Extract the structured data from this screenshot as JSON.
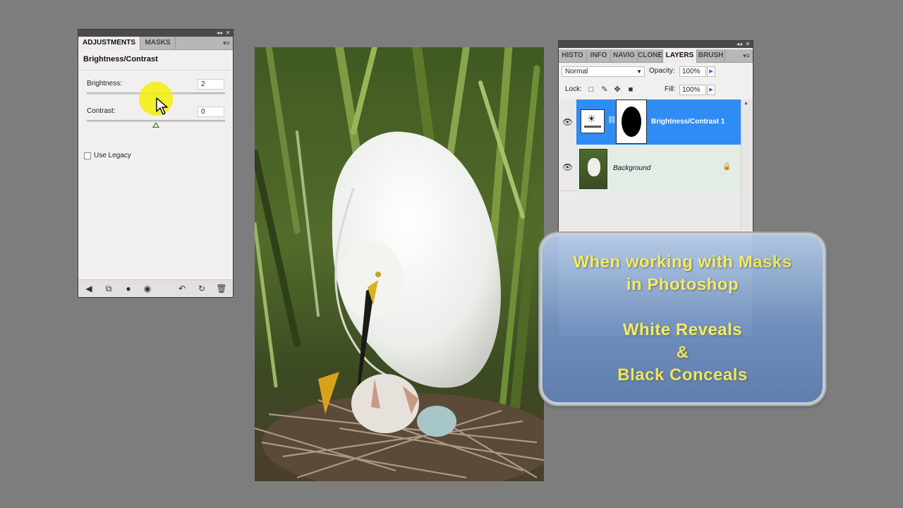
{
  "adjustments_panel": {
    "tabs": [
      {
        "label": "ADJUSTMENTS",
        "active": true
      },
      {
        "label": "MASKS",
        "active": false
      }
    ],
    "title": "Brightness/Contrast",
    "brightness": {
      "label": "Brightness:",
      "value": "2",
      "slider_fraction": 0.51
    },
    "contrast": {
      "label": "Contrast:",
      "value": "0",
      "slider_fraction": 0.5
    },
    "use_legacy": {
      "label": "Use Legacy",
      "checked": false
    },
    "bottom_icons": [
      "back-arrow-icon",
      "clip-layer-icon",
      "view-previous-icon",
      "visibility-eye-icon",
      "reset-icon",
      "refresh-icon",
      "trash-icon"
    ]
  },
  "layers_panel": {
    "tabs": [
      {
        "label": "HISTO",
        "active": false
      },
      {
        "label": "INFO",
        "active": false
      },
      {
        "label": "NAVIG",
        "active": false
      },
      {
        "label": "CLONE",
        "active": false
      },
      {
        "label": "LAYERS",
        "active": true
      },
      {
        "label": "BRUSH",
        "active": false
      }
    ],
    "blend_mode": "Normal",
    "opacity_label": "Opacity:",
    "opacity_value": "100%",
    "lock_label": "Lock:",
    "fill_label": "Fill:",
    "fill_value": "100%",
    "layers": [
      {
        "name": "Brightness/Contrast 1",
        "selected": true,
        "visible": true
      },
      {
        "name": "Background",
        "selected": false,
        "visible": true,
        "locked": true
      }
    ]
  },
  "overlay": {
    "lines": [
      "When working with Masks",
      "in Photoshop",
      "White Reveals",
      "&",
      "Black Conceals"
    ]
  },
  "colors": {
    "background": "#7d7d7d",
    "selected_layer": "#2f8cf4",
    "overlay_text": "#f2ec5a",
    "highlight": "#f4ef1a"
  }
}
